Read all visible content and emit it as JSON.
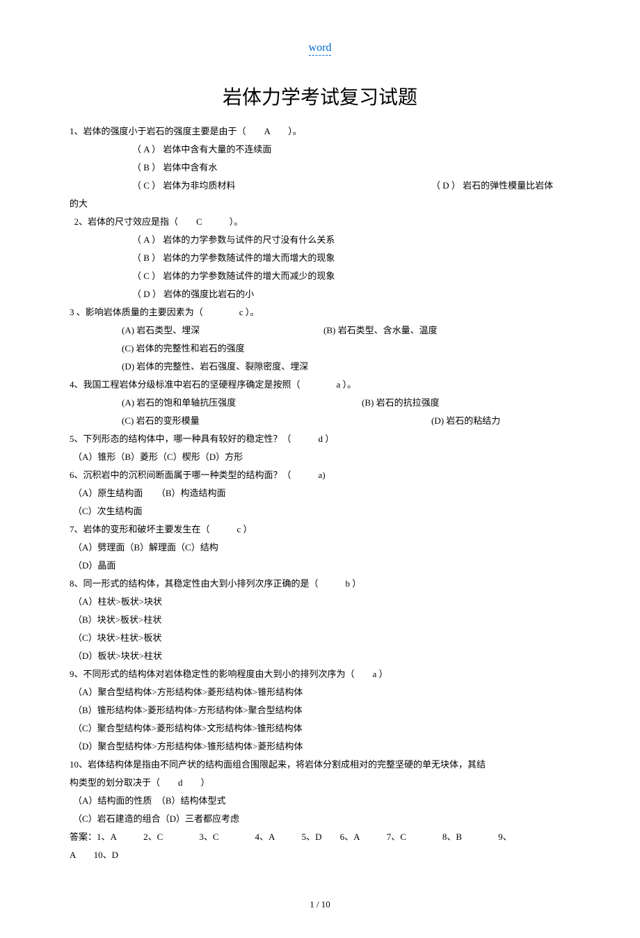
{
  "header": {
    "word": "word"
  },
  "title": "岩体力学考试复习试题",
  "q1": {
    "stem": "1、岩体的强度小于岩石的强度主要是由于（　　A　　）。",
    "a": "（ A ） 岩体中含有大量的不连续面",
    "b": "（ B ） 岩体中含有水",
    "c": "（ C ） 岩体为非均质材料",
    "d": "（ D ） 岩石的弹性模量比岩体",
    "d_tail": "的大"
  },
  "q2": {
    "stem": "  2、岩体的尺寸效应是指（　　C　　　）。",
    "a": "（ A ） 岩体的力学参数与试件的尺寸没有什么关系",
    "b": "（ B ） 岩体的力学参数随试件的增大而增大的现象",
    "c": "（ C ） 岩体的力学参数随试件的增大而减少的现象",
    "d": "（ D ） 岩体的强度比岩石的小"
  },
  "q3": {
    "stem": "3 、影响岩体质量的主要因素为（　　　　c ）。",
    "a": "(A) 岩石类型、埋深",
    "b": "(B) 岩石类型、含水量、温度",
    "c": "(C) 岩体的完整性和岩石的强度",
    "d": "(D) 岩体的完整性、岩石强度、裂隙密度、埋深"
  },
  "q4": {
    "stem": "4、我国工程岩体分级标准中岩石的坚硬程序确定是按照（　　　　a ）。",
    "a": "(A) 岩石的饱和单轴抗压强度",
    "b": "(B) 岩石的抗拉强度",
    "c": "(C) 岩石的变形模量",
    "d": "(D) 岩石的粘结力"
  },
  "q5": {
    "stem": "5、下列形态的结构体中，哪一种具有较好的稳定性？（　　　d ）",
    "opts": "（A）锥形（B）菱形（C）楔形（D）方形"
  },
  "q6": {
    "stem": "6、沉积岩中的沉积间断面属于哪一种类型的结构面？（　　　a)",
    "ab": "（A）原生结构面　　（B）构造结构面",
    "c": "（C）次生结构面"
  },
  "q7": {
    "stem": "7、岩体的变形和破坏主要发生在（　　　c ）",
    "abc": "（A）劈理面（B）解理面（C）结构",
    "d": "（D）晶面"
  },
  "q8": {
    "stem": "8、同一形式的结构体，其稳定性由大到小排列次序正确的是（　　　b ）",
    "a": "（A）柱状>板状>块状",
    "b": "（B）块状>板状>柱状",
    "c": "（C）块状>柱状>板状",
    "d": "（D）板状>块状>柱状"
  },
  "q9": {
    "stem": "9、不同形式的结构体对岩体稳定性的影响程度由大到小的排列次序为（　　a ）",
    "a": "（A）聚合型结构体>方形结构体>菱形结构体>锥形结构体",
    "b": "（B）锥形结构体>菱形结构体>方形结构体>聚合型结构体",
    "c": "（C）聚合型结构体>菱形结构体>文形结构体>锥形结构体",
    "d": "（D）聚合型结构体>方形结构体>锥形结构体>菱形结构体"
  },
  "q10": {
    "stem": "10、岩体结构体是指由不同产状的结构面组合围限起来，将岩体分割成相对的完整坚硬的单无块体，其结",
    "stem2": "构类型的划分取决于（　　d　　）",
    "ab": "（A）结构面的性质　（B）结构体型式",
    "cd": "（C）岩石建造的组合（D）三者都应考虑"
  },
  "answers": {
    "line1": "答案：1、A　　　2、C　　　　3、C　　　　4、A　　　5、D　　6、A　　　7、C　　　　8、B　　　　9、",
    "line2": "A　　10、D"
  },
  "footer": "1 / 10"
}
